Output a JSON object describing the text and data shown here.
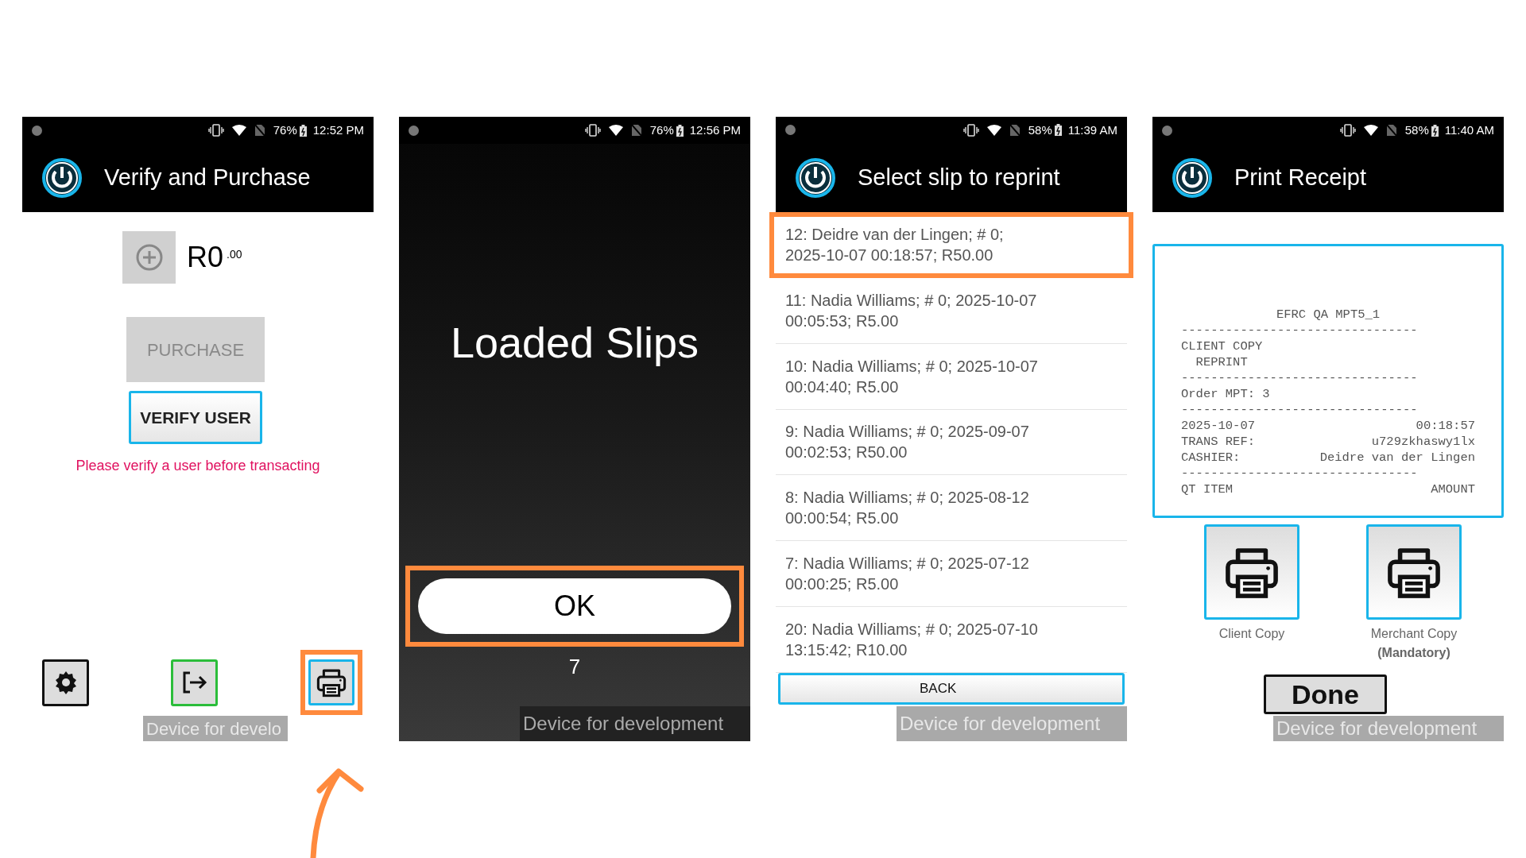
{
  "screens": [
    {
      "kind": "verify",
      "status_bar": {
        "battery": "76%",
        "time": "12:52 PM"
      },
      "title": "Verify and Purchase",
      "amount": "R0",
      "cents": ".00",
      "purchase_button": {
        "label": "PURCHASE",
        "disabled": true
      },
      "verify_button": {
        "label": "VERIFY USER"
      },
      "warning": "Please verify a user before transacting",
      "print_button": {
        "highlighted": true
      },
      "overlay": "Device for develo"
    },
    {
      "kind": "loaded",
      "status_bar": {
        "battery": "76%",
        "time": "12:56 PM"
      },
      "heading": "Loaded Slips",
      "ok_button": {
        "label": "OK",
        "highlighted": true
      },
      "count": "7",
      "overlay": "Device for development"
    },
    {
      "kind": "slips",
      "status_bar": {
        "battery": "58%",
        "time": "11:39 AM"
      },
      "title": "Select slip to reprint",
      "slips": [
        {
          "lines": [
            "12: Deidre van der Lingen; # 0;",
            "2025-10-07 00:18:57; R50.00"
          ],
          "highlighted": true
        },
        {
          "lines": [
            "11: Nadia Williams; # 0; 2025-10-07",
            "00:05:53; R5.00"
          ],
          "highlighted": false
        },
        {
          "lines": [
            "10: Nadia Williams; # 0; 2025-10-07",
            "00:04:40; R5.00"
          ],
          "highlighted": false
        },
        {
          "lines": [
            "9: Nadia Williams; # 0; 2025-09-07",
            "00:02:53; R50.00"
          ],
          "highlighted": false
        },
        {
          "lines": [
            "8: Nadia Williams; # 0; 2025-08-12",
            "00:00:54; R5.00"
          ],
          "highlighted": false
        },
        {
          "lines": [
            "7: Nadia Williams; # 0; 2025-07-12",
            "00:00:25; R5.00"
          ],
          "highlighted": false
        },
        {
          "lines": [
            "20: Nadia Williams; # 0; 2025-07-10",
            "13:15:42; R10.00"
          ],
          "highlighted": false
        }
      ],
      "back_button": {
        "label": "BACK"
      },
      "overlay": "Device for development"
    },
    {
      "kind": "receipt",
      "status_bar": {
        "battery": "58%",
        "time": "11:40 AM"
      },
      "title": "Print Receipt",
      "receipt": [
        {
          "kind": "center",
          "text": "EFRC QA MPT5_1"
        },
        {
          "kind": "line",
          "text": "--------------------------------"
        },
        {
          "kind": "line",
          "text": "CLIENT COPY"
        },
        {
          "kind": "line",
          "text": "  REPRINT"
        },
        {
          "kind": "line",
          "text": "--------------------------------"
        },
        {
          "kind": "line",
          "text": "Order MPT: 3"
        },
        {
          "kind": "line",
          "text": "--------------------------------"
        },
        {
          "kind": "pair",
          "left": "2025-10-07",
          "right": "00:18:57"
        },
        {
          "kind": "pair",
          "left": "TRANS REF:",
          "right": "u729zkhaswy1lx"
        },
        {
          "kind": "pair",
          "left": "CASHIER:",
          "right": "Deidre van der Lingen"
        },
        {
          "kind": "line",
          "text": "--------------------------------"
        },
        {
          "kind": "pair",
          "left": "QT ITEM",
          "right": "AMOUNT"
        }
      ],
      "print_options": [
        {
          "label": "Client Copy"
        },
        {
          "label": "Merchant Copy",
          "note": "(Mandatory)"
        }
      ],
      "done_button": {
        "label": "Done"
      },
      "overlay": "Device for development"
    }
  ]
}
